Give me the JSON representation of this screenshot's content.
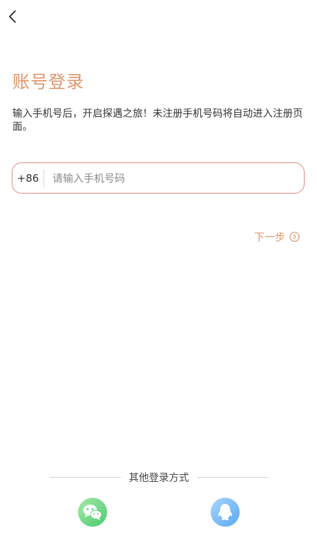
{
  "colors": {
    "accent": "#e0956a",
    "border": "#e08a80",
    "wechat_start": "#a6e8a8",
    "wechat_end": "#4bcb6f",
    "qq_start": "#a8d5ff",
    "qq_end": "#5aa8f0"
  },
  "header": {
    "back_icon": "chevron-left-icon"
  },
  "title": "账号登录",
  "subtitle": "输入手机号后，开启探遇之旅！未注册手机号码将自动进入注册页面。",
  "phone": {
    "country_code": "+86",
    "placeholder": "请输入手机号码",
    "value": ""
  },
  "next_step": {
    "label": "下一步",
    "icon": "chevron-circle-right-icon"
  },
  "other_login": {
    "title": "其他登录方式",
    "options": [
      {
        "name": "wechat",
        "icon": "wechat-icon"
      },
      {
        "name": "qq",
        "icon": "qq-icon"
      }
    ]
  }
}
